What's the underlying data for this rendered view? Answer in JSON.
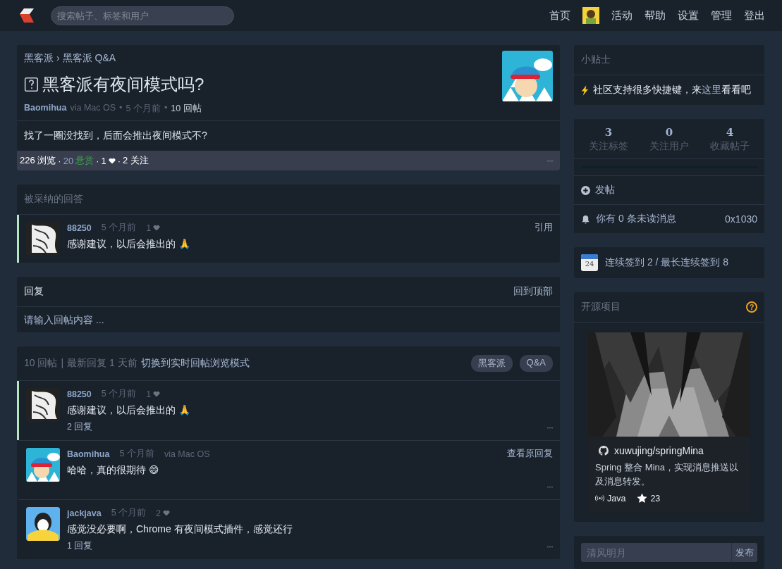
{
  "header": {
    "search_placeholder": "搜索帖子、标签和用户",
    "nav": [
      {
        "kind": "link",
        "label": "首页"
      },
      {
        "kind": "avatar"
      },
      {
        "kind": "link",
        "label": "活动"
      },
      {
        "kind": "link",
        "label": "帮助"
      },
      {
        "kind": "link",
        "label": "设置"
      },
      {
        "kind": "link",
        "label": "管理"
      },
      {
        "kind": "link",
        "label": "登出"
      }
    ]
  },
  "post": {
    "breadcrumb": [
      "黑客派",
      "黑客派 Q&A"
    ],
    "breadcrumb_separator": "›",
    "title": "黑客派有夜间模式吗?",
    "author": "Baomihua",
    "via": "via Mac OS",
    "time": "5 个月前",
    "replies": "10 回帖",
    "meta_separator": "•",
    "body": "找了一圈没找到，后面会推出夜间模式不?",
    "stats": [
      {
        "kind": "plain",
        "text": "226 浏览"
      },
      {
        "kind": "sep",
        "text": "·"
      },
      {
        "kind": "muted",
        "text": "20"
      },
      {
        "kind": "green",
        "text": "悬赏"
      },
      {
        "kind": "sep",
        "text": "·"
      },
      {
        "kind": "plain",
        "text": "1"
      },
      {
        "kind": "heart"
      },
      {
        "kind": "sep",
        "text": "·"
      },
      {
        "kind": "plain",
        "text": "2 关注"
      }
    ],
    "more": "···"
  },
  "accepted": {
    "title": "被采纳的回答",
    "item": {
      "avatar": {
        "kind": "sketch"
      },
      "author": "88250",
      "time": "5 个月前",
      "likes": "1",
      "action": "引用",
      "body": "感谢建议，以后会推出的 🙏"
    }
  },
  "reply_box": {
    "title": "回复",
    "back_to_top": "回到顶部",
    "placeholder": "请输入回帖内容 ..."
  },
  "comments": {
    "count": "10 回帖",
    "separator": "|",
    "latest": "最新回复 1 天前",
    "switch_mode": "切换到实时回帖浏览模式",
    "tags": [
      "黑客派",
      "Q&A"
    ],
    "items": [
      {
        "accepted": true,
        "avatar": {
          "kind": "sketch"
        },
        "author": "88250",
        "time": "5 个月前",
        "likes": "1",
        "body": "感谢建议，以后会推出的 🙏",
        "replies": "2 回复",
        "more": "···"
      },
      {
        "accepted": false,
        "avatar": {
          "kind": "pattern"
        },
        "author": "Baomihua",
        "time": "5 个月前",
        "via": "via Mac OS",
        "action": "查看原回复",
        "body": "哈哈，真的很期待 😄",
        "more": "···"
      },
      {
        "accepted": false,
        "avatar": {
          "kind": "bird"
        },
        "author": "jackjava",
        "time": "5 个月前",
        "likes": "2",
        "body": "感觉没必要啊，Chrome 有夜间模式插件，感觉还行",
        "replies": "1 回复",
        "more": "···"
      }
    ]
  },
  "sidebar": {
    "tips": {
      "title": "小贴士",
      "text_before": "社区支持很多快捷键，来",
      "link": "这里",
      "text_after": "看看吧"
    },
    "stats": [
      {
        "value": "3",
        "label": "关注标签"
      },
      {
        "value": "0",
        "label": "关注用户"
      },
      {
        "value": "4",
        "label": "收藏帖子"
      }
    ],
    "progress": {
      "level": 0
    },
    "new_post": "发帖",
    "notifications": "你有 0 条未读消息",
    "points": "0x1030",
    "checkin": {
      "day": "24",
      "text": "连续签到 2 / 最长连续签到 8"
    },
    "open_source": {
      "title": "开源项目",
      "help": "?",
      "repo": "xuwujing/springMina",
      "description": "Spring 整合 Mina，实现消息推送以及消息转发。",
      "language": "Java",
      "star_count": "23"
    },
    "quick_post": {
      "placeholder": "清风明月",
      "button": "发布"
    }
  }
}
